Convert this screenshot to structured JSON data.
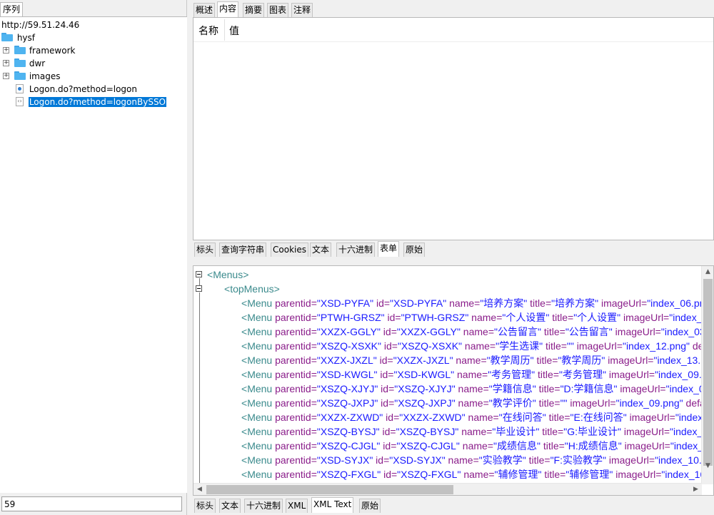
{
  "left": {
    "tab_label": "序列",
    "tree": {
      "host": "http://59.51.24.46",
      "root_folder": "hysf",
      "folders": [
        "framework",
        "dwr",
        "images"
      ],
      "files": [
        "Logon.do?method=logon",
        "Logon.do?method=logonBySSO"
      ],
      "expand_symbol": "+"
    },
    "filter_value": "59"
  },
  "top_tabs": [
    "概述",
    "内容",
    "摘要",
    "图表",
    "注释"
  ],
  "top_active": "内容",
  "request_table": {
    "col_name": "名称",
    "col_value": "值"
  },
  "request_tabs": [
    "标头",
    "查询字符串",
    "Cookies",
    "文本",
    "十六进制",
    "表单",
    "原始"
  ],
  "request_active": "表单",
  "response_tabs": [
    "标头",
    "文本",
    "十六进制",
    "XML",
    "XML Text",
    "原始"
  ],
  "response_active": "XML Text",
  "xml": {
    "root_tag": "Menus",
    "group_tag": "topMenus",
    "menus": [
      [
        [
          "Menu",
          "tag"
        ],
        [
          " parentid=",
          "attr"
        ],
        [
          "\"XSD-PYFA\"",
          "val"
        ],
        [
          " id=",
          "attr"
        ],
        [
          "\"XSD-PYFA\"",
          "val"
        ],
        [
          " name=",
          "attr"
        ],
        [
          "\"培养方案\"",
          "val"
        ],
        [
          " title=",
          "attr"
        ],
        [
          "\"培养方案\"",
          "val"
        ],
        [
          " imageUrl=",
          "attr"
        ],
        [
          "\"index_06.pn",
          "val"
        ]
      ],
      [
        [
          "Menu",
          "tag"
        ],
        [
          " parentid=",
          "attr"
        ],
        [
          "\"PTWH-GRSZ\"",
          "val"
        ],
        [
          " id=",
          "attr"
        ],
        [
          "\"PTWH-GRSZ\"",
          "val"
        ],
        [
          " name=",
          "attr"
        ],
        [
          "\"个人设置\"",
          "val"
        ],
        [
          " title=",
          "attr"
        ],
        [
          "\"个人设置\"",
          "val"
        ],
        [
          " imageUrl=",
          "attr"
        ],
        [
          "\"index_1",
          "val"
        ]
      ],
      [
        [
          "Menu",
          "tag"
        ],
        [
          " parentid=",
          "attr"
        ],
        [
          "\"XXZX-GGLY\"",
          "val"
        ],
        [
          " id=",
          "attr"
        ],
        [
          "\"XXZX-GGLY\"",
          "val"
        ],
        [
          " name=",
          "attr"
        ],
        [
          "\"公告留言\"",
          "val"
        ],
        [
          " title=",
          "attr"
        ],
        [
          "\"公告留言\"",
          "val"
        ],
        [
          " imageUrl=",
          "attr"
        ],
        [
          "\"index_03",
          "val"
        ]
      ],
      [
        [
          "Menu",
          "tag"
        ],
        [
          " parentid=",
          "attr"
        ],
        [
          "\"XSZQ-XSXK\"",
          "val"
        ],
        [
          " id=",
          "attr"
        ],
        [
          "\"XSZQ-XSXK\"",
          "val"
        ],
        [
          " name=",
          "attr"
        ],
        [
          "\"学生选课\"",
          "val"
        ],
        [
          " title=",
          "attr"
        ],
        [
          "\"\"",
          "val"
        ],
        [
          " imageUrl=",
          "attr"
        ],
        [
          "\"index_12.png\"",
          "val"
        ],
        [
          " defa",
          "attr"
        ]
      ],
      [
        [
          "Menu",
          "tag"
        ],
        [
          " parentid=",
          "attr"
        ],
        [
          "\"XXZX-JXZL\"",
          "val"
        ],
        [
          " id=",
          "attr"
        ],
        [
          "\"XXZX-JXZL\"",
          "val"
        ],
        [
          " name=",
          "attr"
        ],
        [
          "\"教学周历\"",
          "val"
        ],
        [
          " title=",
          "attr"
        ],
        [
          "\"教学周历\"",
          "val"
        ],
        [
          " imageUrl=",
          "attr"
        ],
        [
          "\"index_13.pn",
          "val"
        ]
      ],
      [
        [
          "Menu",
          "tag"
        ],
        [
          " parentid=",
          "attr"
        ],
        [
          "\"XSD-KWGL\"",
          "val"
        ],
        [
          " id=",
          "attr"
        ],
        [
          "\"XSD-KWGL\"",
          "val"
        ],
        [
          " name=",
          "attr"
        ],
        [
          "\"考务管理\"",
          "val"
        ],
        [
          " title=",
          "attr"
        ],
        [
          "\"考务管理\"",
          "val"
        ],
        [
          " imageUrl=",
          "attr"
        ],
        [
          "\"index_09.p",
          "val"
        ]
      ],
      [
        [
          "Menu",
          "tag"
        ],
        [
          " parentid=",
          "attr"
        ],
        [
          "\"XSZQ-XJYJ\"",
          "val"
        ],
        [
          " id=",
          "attr"
        ],
        [
          "\"XSZQ-XJYJ\"",
          "val"
        ],
        [
          " name=",
          "attr"
        ],
        [
          "\"学籍信息\"",
          "val"
        ],
        [
          " title=",
          "attr"
        ],
        [
          "\"D:学籍信息\"",
          "val"
        ],
        [
          " imageUrl=",
          "attr"
        ],
        [
          "\"index_07",
          "val"
        ]
      ],
      [
        [
          "Menu",
          "tag"
        ],
        [
          " parentid=",
          "attr"
        ],
        [
          "\"XSZQ-JXPJ\"",
          "val"
        ],
        [
          " id=",
          "attr"
        ],
        [
          "\"XSZQ-JXPJ\"",
          "val"
        ],
        [
          " name=",
          "attr"
        ],
        [
          "\"教学评价\"",
          "val"
        ],
        [
          " title=",
          "attr"
        ],
        [
          "\"\"",
          "val"
        ],
        [
          " imageUrl=",
          "attr"
        ],
        [
          "\"index_09.png\"",
          "val"
        ],
        [
          " defau",
          "attr"
        ]
      ],
      [
        [
          "Menu",
          "tag"
        ],
        [
          " parentid=",
          "attr"
        ],
        [
          "\"XXZX-ZXWD\"",
          "val"
        ],
        [
          " id=",
          "attr"
        ],
        [
          "\"XXZX-ZXWD\"",
          "val"
        ],
        [
          " name=",
          "attr"
        ],
        [
          "\"在线问答\"",
          "val"
        ],
        [
          " title=",
          "attr"
        ],
        [
          "\"E:在线问答\"",
          "val"
        ],
        [
          " imageUrl=",
          "attr"
        ],
        [
          "\"index_1",
          "val"
        ]
      ],
      [
        [
          "Menu",
          "tag"
        ],
        [
          " parentid=",
          "attr"
        ],
        [
          "\"XSZQ-BYSJ\"",
          "val"
        ],
        [
          " id=",
          "attr"
        ],
        [
          "\"XSZQ-BYSJ\"",
          "val"
        ],
        [
          " name=",
          "attr"
        ],
        [
          "\"毕业设计\"",
          "val"
        ],
        [
          " title=",
          "attr"
        ],
        [
          "\"G:毕业设计\"",
          "val"
        ],
        [
          " imageUrl=",
          "attr"
        ],
        [
          "\"index_0",
          "val"
        ]
      ],
      [
        [
          "Menu",
          "tag"
        ],
        [
          " parentid=",
          "attr"
        ],
        [
          "\"XSZQ-CJGL\"",
          "val"
        ],
        [
          " id=",
          "attr"
        ],
        [
          "\"XSZQ-CJGL\"",
          "val"
        ],
        [
          " name=",
          "attr"
        ],
        [
          "\"成绩信息\"",
          "val"
        ],
        [
          " title=",
          "attr"
        ],
        [
          "\"H:成绩信息\"",
          "val"
        ],
        [
          " imageUrl=",
          "attr"
        ],
        [
          "\"index_1",
          "val"
        ]
      ],
      [
        [
          "Menu",
          "tag"
        ],
        [
          " parentid=",
          "attr"
        ],
        [
          "\"XSD-SYJX\"",
          "val"
        ],
        [
          " id=",
          "attr"
        ],
        [
          "\"XSD-SYJX\"",
          "val"
        ],
        [
          " name=",
          "attr"
        ],
        [
          "\"实验教学\"",
          "val"
        ],
        [
          " title=",
          "attr"
        ],
        [
          "\"F:实验教学\"",
          "val"
        ],
        [
          " imageUrl=",
          "attr"
        ],
        [
          "\"index_10.p",
          "val"
        ]
      ],
      [
        [
          "Menu",
          "tag"
        ],
        [
          " parentid=",
          "attr"
        ],
        [
          "\"XSZQ-FXGL\"",
          "val"
        ],
        [
          " id=",
          "attr"
        ],
        [
          "\"XSZQ-FXGL\"",
          "val"
        ],
        [
          " name=",
          "attr"
        ],
        [
          "\"辅修管理\"",
          "val"
        ],
        [
          " title=",
          "attr"
        ],
        [
          "\"辅修管理\"",
          "val"
        ],
        [
          " imageUrl=",
          "attr"
        ],
        [
          "\"index_16",
          "val"
        ]
      ]
    ]
  },
  "colors": {
    "xml_tag": "#3a8a8c",
    "xml_attr": "#8a1d8a",
    "xml_value": "#1a1aff",
    "selection": "#0078d7",
    "folder": "#4fb4f0"
  }
}
